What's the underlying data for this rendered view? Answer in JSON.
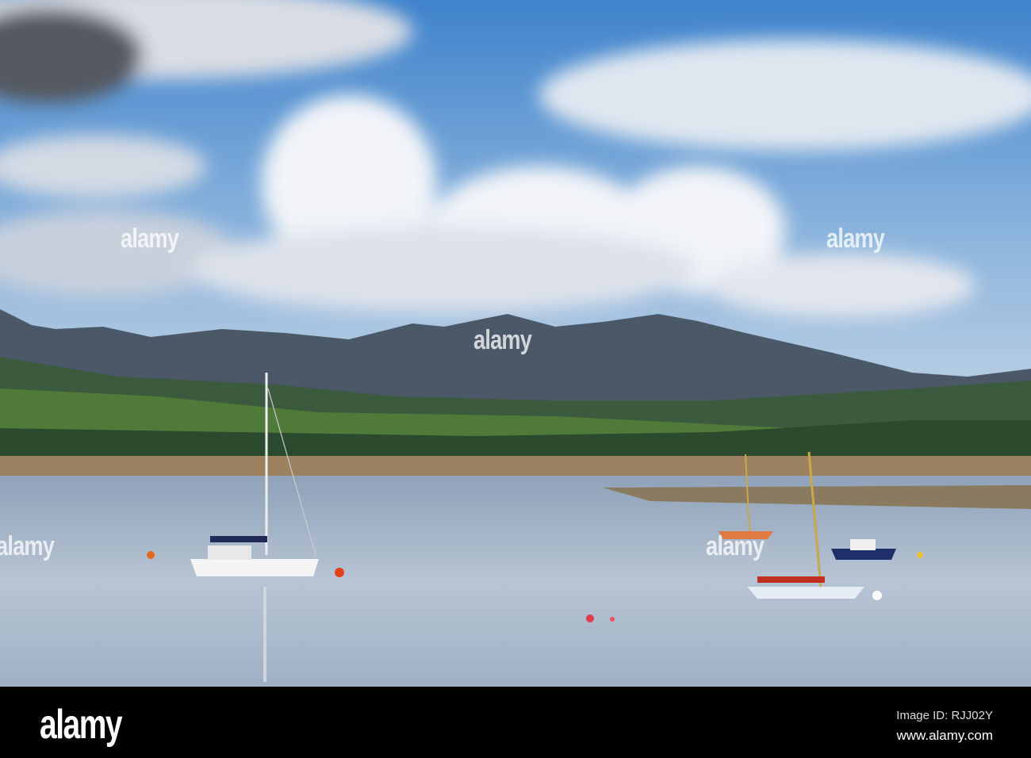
{
  "photo": {
    "description_alt": "Sailboats moored on calm estuary with mountains and clouds"
  },
  "watermark": {
    "text": "alamy"
  },
  "footer": {
    "logo": "alamy",
    "image_id": "Image ID: RJJ02Y",
    "website": "www.alamy.com"
  },
  "colors": {
    "sky": "#4d8ed0",
    "water": "#a9b8cc",
    "sand": "#9b8160",
    "bar": "#000000"
  }
}
